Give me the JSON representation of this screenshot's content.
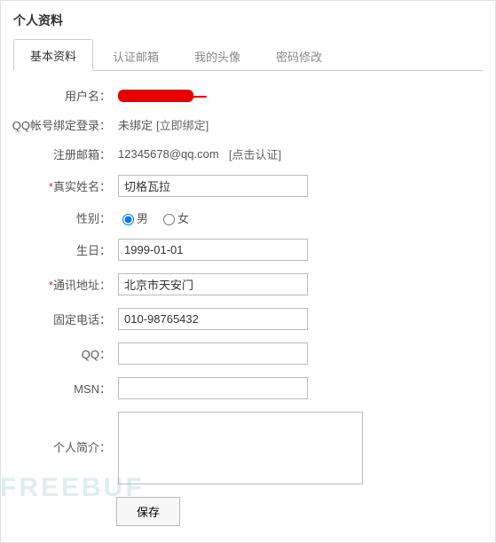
{
  "page_title": "个人资料",
  "tabs": {
    "basic": "基本资料",
    "email": "认证邮箱",
    "avatar": "我的头像",
    "password": "密码修改"
  },
  "labels": {
    "username": "用户名：",
    "qq_bind": "QQ帐号绑定登录：",
    "email": "注册邮箱：",
    "realname": "真实姓名：",
    "gender": "性别：",
    "birthday": "生日：",
    "address": "通讯地址：",
    "phone": "固定电话：",
    "qq": "QQ：",
    "msn": "MSN：",
    "intro": "个人简介："
  },
  "values": {
    "qq_bind_status": "未绑定",
    "qq_bind_action": "[立即绑定]",
    "email": "12345678@qq.com",
    "email_action": "[点击认证]",
    "realname": "切格瓦拉",
    "gender_male": "男",
    "gender_female": "女",
    "birthday": "1999-01-01",
    "address": "北京市天安门",
    "phone": "010-98765432",
    "qq": "",
    "msn": "",
    "intro": ""
  },
  "buttons": {
    "save": "保存"
  },
  "watermark": "FREEBUF"
}
